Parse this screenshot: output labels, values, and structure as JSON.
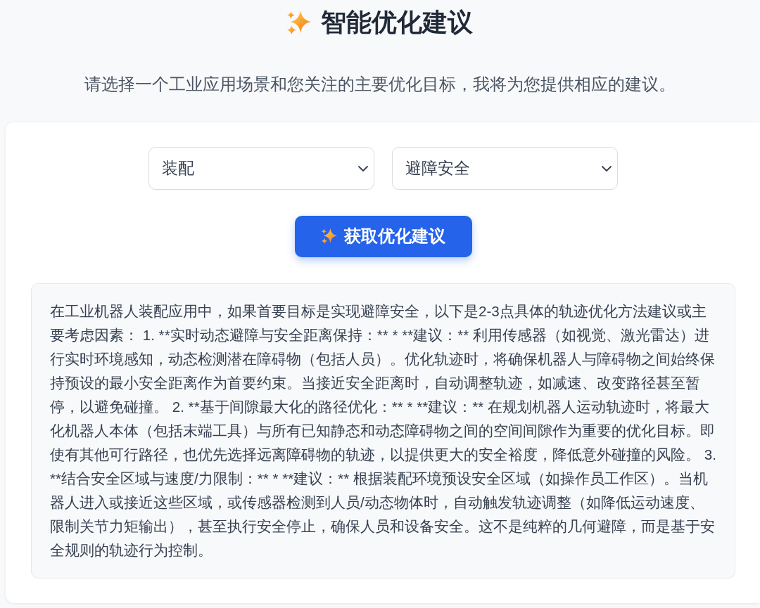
{
  "header": {
    "title": "智能优化建议",
    "subtitle": "请选择一个工业应用场景和您关注的主要优化目标，我将为您提供相应的建议。"
  },
  "form": {
    "selects": [
      {
        "value": "装配"
      },
      {
        "value": "避障安全"
      }
    ],
    "submit_button": {
      "label": "获取优化建议"
    }
  },
  "result": {
    "text": "在工业机器人装配应用中，如果首要目标是实现避障安全，以下是2-3点具体的轨迹优化方法建议或主要考虑因素： 1. **实时动态避障与安全距离保持：** * **建议：** 利用传感器（如视觉、激光雷达）进行实时环境感知，动态检测潜在障碍物（包括人员）。优化轨迹时，将确保机器人与障碍物之间始终保持预设的最小安全距离作为首要约束。当接近安全距离时，自动调整轨迹，如减速、改变路径甚至暂停，以避免碰撞。 2. **基于间隙最大化的路径优化：** * **建议：** 在规划机器人运动轨迹时，将最大化机器人本体（包括末端工具）与所有已知静态和动态障碍物之间的空间间隙作为重要的优化目标。即使有其他可行路径，也优先选择远离障碍物的轨迹，以提供更大的安全裕度，降低意外碰撞的风险。 3. **结合安全区域与速度/力限制：** * **建议：** 根据装配环境预设安全区域（如操作员工作区）。当机器人进入或接近这些区域，或传感器检测到人员/动态物体时，自动触发轨迹调整（如降低运动速度、限制关节力矩输出），甚至执行安全停止，确保人员和设备安全。这不是纯粹的几何避障，而是基于安全规则的轨迹行为控制。"
  }
}
